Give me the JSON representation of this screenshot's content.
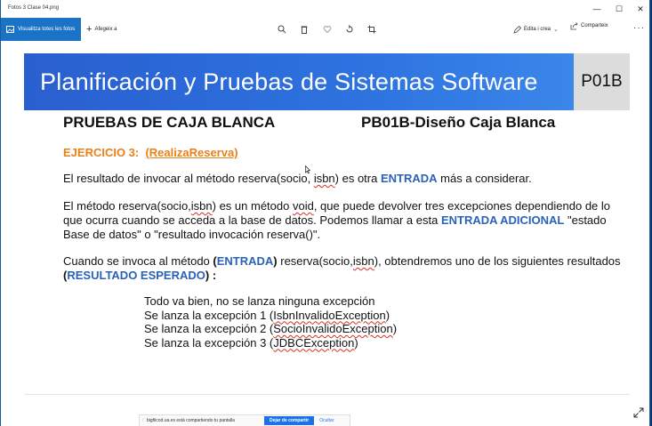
{
  "window": {
    "title": "Fotos 3 Clase 04.png",
    "controls": {
      "minimize": "—",
      "maximize": "☐",
      "close": "✕"
    }
  },
  "toolbar": {
    "view_all_label": "Visualitza totes les fotos",
    "add_label": "Afegeix a",
    "edit_label": "Edita i crea",
    "share_label": "Comparteix",
    "more_label": "···"
  },
  "slide": {
    "banner_title": "Planificación y Pruebas de Sistemas Software",
    "code": "P01B",
    "heading_left": "PRUEBAS DE CAJA BLANCA",
    "heading_right": "PB01B-Diseño Caja Blanca",
    "exercise_prefix": "EJERCICIO 3:  ",
    "exercise_name": "(RealizaReserva)",
    "p1": {
      "a": "El resultado de invocar al método reserva(socio, ",
      "b": "isbn",
      "c": ") es otra ",
      "kw": "ENTRADA",
      "d": " más a considerar."
    },
    "p2": {
      "a": "El método reserva(socio,",
      "b": "isbn",
      "c": ") es un método ",
      "d": "void",
      "e": ", que puede devolver tres excepciones dependiendo de lo que ocurra cuando se acceda a la base de datos. Podemos llamar a esta ",
      "kw": "ENTRADA ADICIONAL",
      "f": " \"estado Base de datos\" o \"resultado invocación reserva()\"."
    },
    "p3": {
      "a": "Cuando se invoca al método ",
      "b": "(",
      "kw1": "ENTRADA",
      "c": ")",
      "d": " reserva(socio,",
      "e": "isbn",
      "f": "), obtendremos uno de los siguientes resultados ",
      "g": "(",
      "kw2": "RESULTADO ESPERADO",
      "h": ") :"
    },
    "list": [
      {
        "pre": "Todo va bien, no se lanza ninguna excepción",
        "sp": "",
        "post": ""
      },
      {
        "pre": "Se lanza la excepción 1 (",
        "sp": "IsbnInvalidoException",
        "post": ")"
      },
      {
        "pre": "Se lanza la excepción 2 (",
        "sp": "SocioInvalidoException",
        "post": ")"
      },
      {
        "pre": "Se lanza la excepción 3 (",
        "sp": "JDBCException",
        "post": ")"
      }
    ]
  },
  "share_bar": {
    "message": "bigfiicod.ua.es está compartiendo tu pantalla",
    "stop_label": "Dejar de compartir",
    "hide_label": "Ocultar"
  },
  "colors": {
    "accent": "#1a73c7",
    "banner": "#2d72e0",
    "orange": "#e8811a",
    "keyword": "#2a62b8"
  }
}
